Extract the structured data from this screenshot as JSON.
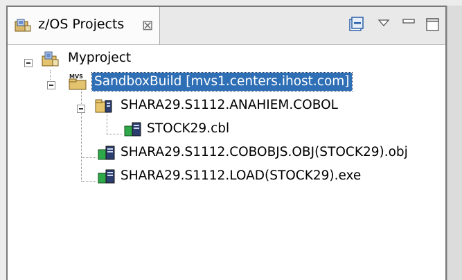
{
  "view": {
    "title": "z/OS Projects",
    "close_symbol": "⊠"
  },
  "toolbar": {
    "collapse_all_icon": "collapse-all-icon",
    "view_menu_icon": "view-menu-icon",
    "minimize_icon": "minimize-icon",
    "maximize_icon": "maximize-icon"
  },
  "tree": {
    "nodes": [
      {
        "label": "Myproject",
        "icon": "project-icon",
        "expanded": true
      },
      {
        "label": "SandboxBuild  [mvs1.centers.ihost.com]",
        "icon": "mvs-subproject-icon",
        "expanded": true,
        "selected": true
      },
      {
        "label": "SHARA29.S1112.ANAHIEM.COBOL",
        "icon": "pds-folder-icon",
        "expanded": true
      },
      {
        "label": "STOCK29.cbl",
        "icon": "member-icon"
      },
      {
        "label": "SHARA29.S1112.COBOBJS.OBJ(STOCK29).obj",
        "icon": "dataset-member-icon"
      },
      {
        "label": "SHARA29.S1112.LOAD(STOCK29).exe",
        "icon": "dataset-member-icon"
      }
    ]
  },
  "colors": {
    "selection": "#2f6fb6",
    "tab_bg": "#fbfbfb",
    "tree_bg": "#ffffff"
  }
}
